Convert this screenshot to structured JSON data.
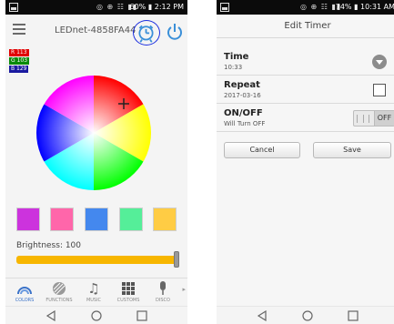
{
  "left_screen": {
    "status": {
      "battery_pct": "60%",
      "time": "2:12 PM"
    },
    "header": {
      "device_name": "LEDnet-4858FA44"
    },
    "rgb": {
      "r": "R 113",
      "g": "G 103",
      "b": "B 129"
    },
    "swatch_colors": [
      "#cc33dd",
      "#ff66aa",
      "#4488ee",
      "#55ee99",
      "#ffcc44"
    ],
    "brightness_label": "Brightness: 100",
    "brightness_value": 100,
    "tabs": [
      {
        "label": "COLORS",
        "icon": "rainbow-icon",
        "active": true
      },
      {
        "label": "FUNCTIONS",
        "icon": "functions-icon",
        "active": false
      },
      {
        "label": "MUSIC",
        "icon": "music-note-icon",
        "active": false
      },
      {
        "label": "CUSTOMS",
        "icon": "grid-icon",
        "active": false
      },
      {
        "label": "DISCO",
        "icon": "microphone-icon",
        "active": false
      }
    ]
  },
  "right_screen": {
    "status": {
      "battery_pct": "74%",
      "time": "10:31 AM"
    },
    "title": "Edit Timer",
    "time": {
      "label": "Time",
      "value": "10:33"
    },
    "repeat": {
      "label": "Repeat",
      "value": "2017-03-16",
      "checked": false
    },
    "onoff": {
      "label": "ON/OFF",
      "value": "Will Turn OFF",
      "toggle_text": "OFF"
    },
    "cancel_label": "Cancel",
    "save_label": "Save"
  },
  "colors": {
    "accent_blue": "#1c2ee0",
    "slider": "#f7b600",
    "tab_active": "#3a72c8"
  }
}
